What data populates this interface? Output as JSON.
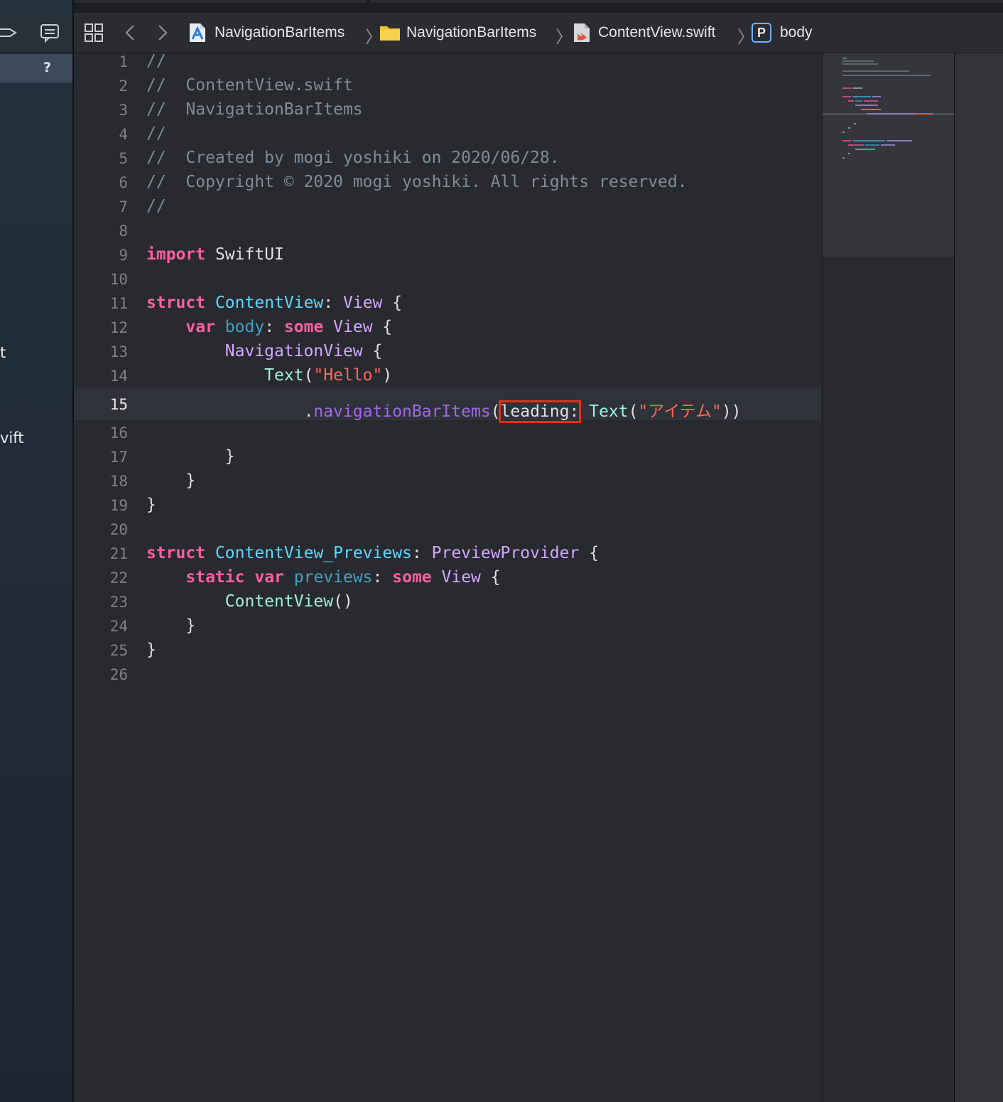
{
  "jump_bar": {
    "items": [
      {
        "label": "NavigationBarItems",
        "icon": "xcode-project-icon"
      },
      {
        "label": "NavigationBarItems",
        "icon": "folder-icon"
      },
      {
        "label": "ContentView.swift",
        "icon": "swift-file-icon"
      },
      {
        "label": "body",
        "icon": "property-icon",
        "badge": "P"
      }
    ]
  },
  "sidebar": {
    "selected_badge": "?",
    "visible_fragments": [
      "t",
      "vift"
    ]
  },
  "editor": {
    "current_line": 15,
    "highlighted_token": "leading:",
    "lines": [
      {
        "n": "1"
      },
      {
        "n": "2"
      },
      {
        "n": "3"
      },
      {
        "n": "4"
      },
      {
        "n": "5"
      },
      {
        "n": "6"
      },
      {
        "n": "7"
      },
      {
        "n": "8"
      },
      {
        "n": "9"
      },
      {
        "n": "10"
      },
      {
        "n": "11"
      },
      {
        "n": "12"
      },
      {
        "n": "13"
      },
      {
        "n": "14"
      },
      {
        "n": "15"
      },
      {
        "n": "16"
      },
      {
        "n": "17"
      },
      {
        "n": "18"
      },
      {
        "n": "19"
      },
      {
        "n": "20"
      },
      {
        "n": "21"
      },
      {
        "n": "22"
      },
      {
        "n": "23"
      },
      {
        "n": "24"
      },
      {
        "n": "25"
      },
      {
        "n": "26"
      }
    ],
    "tokens": {
      "c1": "//",
      "c2": "//  ContentView.swift",
      "c3": "//  NavigationBarItems",
      "c4": "//",
      "c5": "//  Created by mogi yoshiki on 2020/06/28.",
      "c6": "//  Copyright © 2020 mogi yoshiki. All rights reserved.",
      "c7": "//",
      "import": "import",
      "swiftui": "SwiftUI",
      "struct": "struct",
      "contentview": "ContentView",
      "colon": ":",
      "view": "View",
      "brace_open": "{",
      "var": "var",
      "body": "body",
      "some": "some",
      "navigationview": "NavigationView",
      "text": "Text",
      "paren_open": "(",
      "paren_close": ")",
      "hello": "\"Hello\"",
      "dot": ".",
      "navbaritems": "navigationBarItems",
      "leading": "leading:",
      "item_text": "\"アイテム\"",
      "close2": "))",
      "brace_close": "}",
      "contentview_previews": "ContentView_Previews",
      "previewprovider": "PreviewProvider",
      "static": "static",
      "previews": "previews",
      "contentview_call": "ContentView",
      "call_parens": "()"
    }
  },
  "colors": {
    "background": "#292a30",
    "keyword": "#fc5fa3",
    "type": "#5dd8ff",
    "system_type": "#d0a8ff",
    "string": "#fc6a5d",
    "comment": "#7f8c98",
    "highlight_box": "#e0301e"
  }
}
